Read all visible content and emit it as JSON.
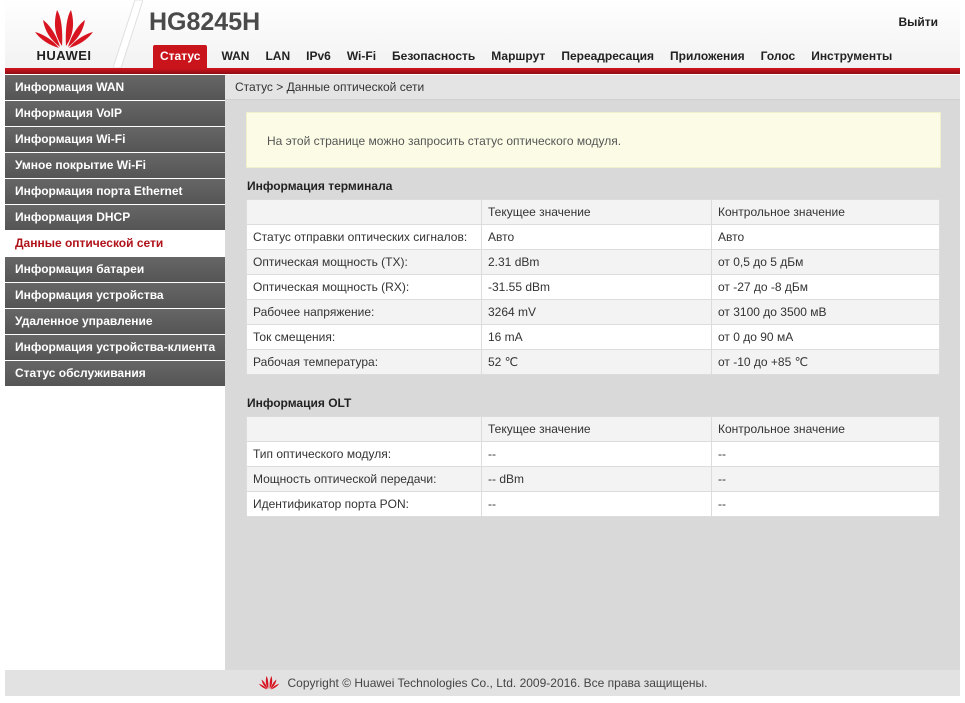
{
  "header": {
    "brand": "HUAWEI",
    "model": "HG8245H",
    "logout_label": "Выйти",
    "brand_color": "#c9141c"
  },
  "nav": {
    "tabs": [
      {
        "label": "Статус",
        "active": true
      },
      {
        "label": "WAN"
      },
      {
        "label": "LAN"
      },
      {
        "label": "IPv6"
      },
      {
        "label": "Wi-Fi"
      },
      {
        "label": "Безопасность"
      },
      {
        "label": "Маршрут"
      },
      {
        "label": "Переадресация"
      },
      {
        "label": "Приложения"
      },
      {
        "label": "Голос"
      },
      {
        "label": "Инструменты"
      }
    ]
  },
  "sidebar": {
    "items": [
      {
        "label": "Информация WAN"
      },
      {
        "label": "Информация VoIP"
      },
      {
        "label": "Информация Wi-Fi"
      },
      {
        "label": "Умное покрытие Wi-Fi"
      },
      {
        "label": "Информация порта Ethernet"
      },
      {
        "label": "Информация DHCP"
      },
      {
        "label": "Данные оптической сети",
        "active": true
      },
      {
        "label": "Информация батареи"
      },
      {
        "label": "Информация устройства"
      },
      {
        "label": "Удаленное управление"
      },
      {
        "label": "Информация устройства-клиента"
      },
      {
        "label": "Статус обслуживания"
      }
    ]
  },
  "main": {
    "breadcrumb": "Статус > Данные оптической сети",
    "notice": "На этой странице можно запросить статус оптического модуля.",
    "terminal": {
      "title": "Информация терминала",
      "columns": [
        "",
        "Текущее значение",
        "Контрольное значение"
      ],
      "rows": [
        [
          "Статус отправки оптических сигналов:",
          "Авто",
          "Авто"
        ],
        [
          "Оптическая мощность (TX):",
          "2.31 dBm",
          "от 0,5 до 5 дБм"
        ],
        [
          "Оптическая мощность (RX):",
          "-31.55 dBm",
          "от -27 до -8 дБм"
        ],
        [
          "Рабочее напряжение:",
          "3264 mV",
          "от 3100 до 3500 мВ"
        ],
        [
          "Ток смещения:",
          "16 mA",
          "от 0 до 90 мА"
        ],
        [
          "Рабочая температура:",
          "52 ℃",
          "от -10 до +85 ℃"
        ]
      ]
    },
    "olt": {
      "title": "Информация OLT",
      "columns": [
        "",
        "Текущее значение",
        "Контрольное значение"
      ],
      "rows": [
        [
          "Тип оптического модуля:",
          "--",
          "--"
        ],
        [
          "Мощность оптической передачи:",
          "-- dBm",
          "--"
        ],
        [
          "Идентификатор порта PON:",
          "--",
          "--"
        ]
      ]
    }
  },
  "footer": {
    "copyright": "Copyright © Huawei Technologies Co., Ltd. 2009-2016. Все права защищены."
  }
}
